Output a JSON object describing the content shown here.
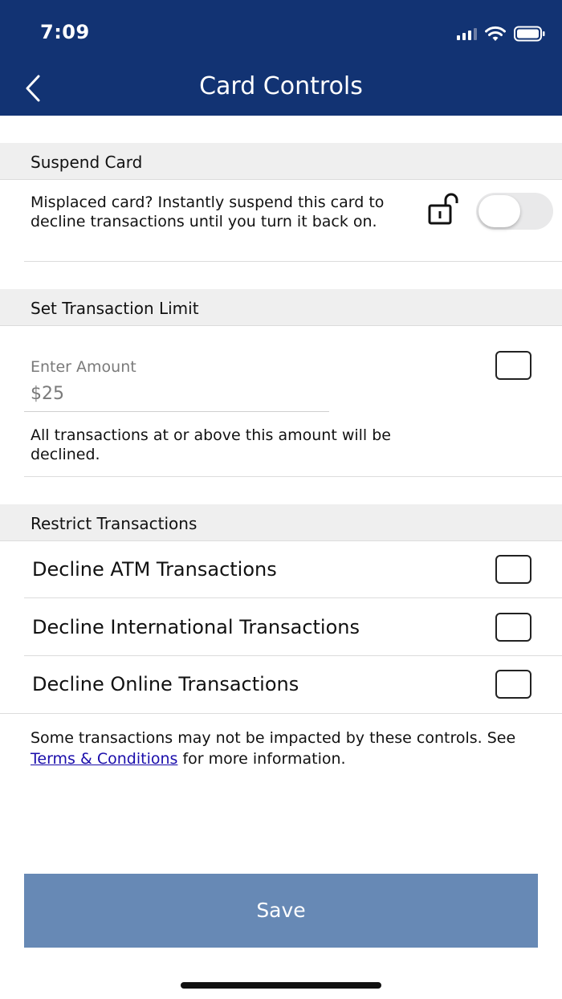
{
  "status_bar": {
    "time": "7:09",
    "signal_icon": "cellular-signal-icon",
    "wifi_icon": "wifi-icon",
    "battery_icon": "battery-icon"
  },
  "nav": {
    "back_icon": "chevron-left-icon",
    "title": "Card Controls",
    "background_color": "#123373"
  },
  "suspend": {
    "header": "Suspend Card",
    "description": "Misplaced card? Instantly suspend this card to decline transactions until you turn it back on.",
    "lock_icon": "unlocked-padlock-icon",
    "toggle_on": false
  },
  "limit": {
    "header": "Set Transaction Limit",
    "input_label": "Enter Amount",
    "input_placeholder": "$25",
    "input_value": "",
    "checked": false,
    "note": "All transactions at or above this amount will be declined."
  },
  "restrict": {
    "header": "Restrict Transactions",
    "items": [
      {
        "label": "Decline ATM Transactions",
        "checked": false
      },
      {
        "label": "Decline International Transactions",
        "checked": false
      },
      {
        "label": "Decline Online Transactions",
        "checked": false
      }
    ]
  },
  "footer": {
    "note_before": "Some transactions may not be impacted by these controls. See ",
    "link_text": "Terms & Conditions",
    "note_after": " for more information."
  },
  "save": {
    "label": "Save",
    "color": "#6789b5"
  }
}
